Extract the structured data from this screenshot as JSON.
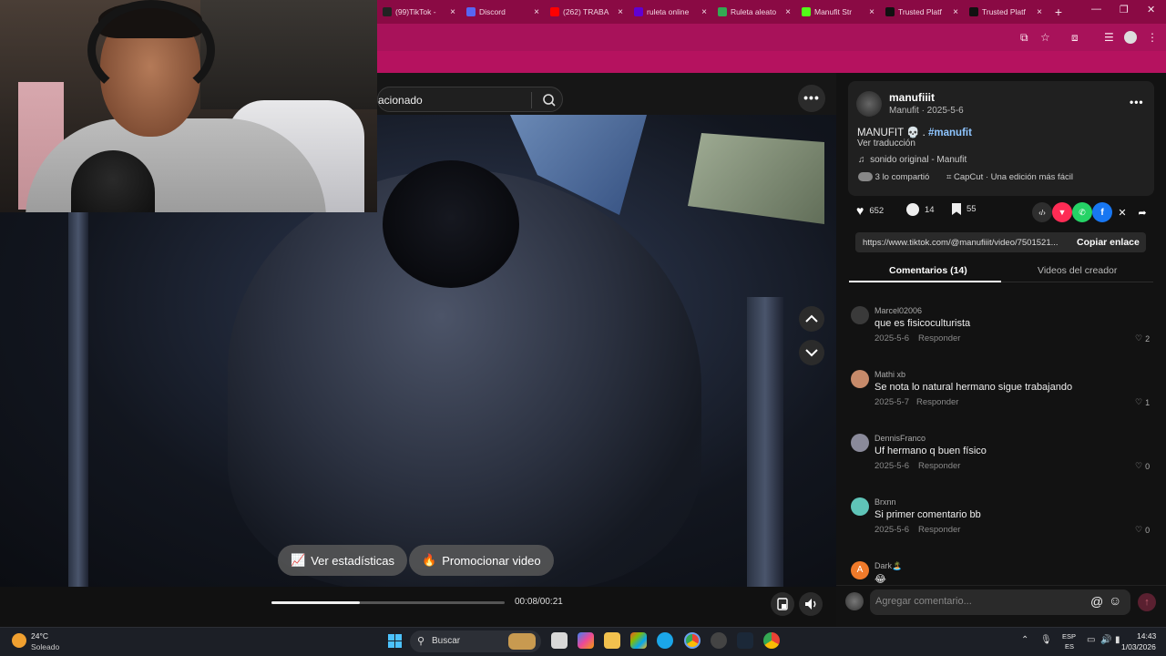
{
  "browser": {
    "tabs": [
      {
        "label": "(99)TikTok -",
        "color": "#222222"
      },
      {
        "label": "Discord",
        "color": "#5865f2"
      },
      {
        "label": "(262) TRABA",
        "color": "#ff0000"
      },
      {
        "label": "ruleta online",
        "color": "#6001d2"
      },
      {
        "label": "Ruleta aleato",
        "color": "#34a853"
      },
      {
        "label": "Manufit Str",
        "color": "#53fc18"
      },
      {
        "label": "Trusted Platf",
        "color": "#111111"
      },
      {
        "label": "Trusted Platf",
        "color": "#111111"
      }
    ],
    "close_glyph": "×",
    "new_tab_glyph": "+",
    "accent": "#8a0a44"
  },
  "search": {
    "value": "acionado"
  },
  "video": {
    "more_glyph": "•••",
    "stats_button": "Ver estadísticas",
    "promote_button": "Promocionar video",
    "time": "00:08/00:21",
    "progress": 0.38
  },
  "post": {
    "username": "manufiiit",
    "meta": "Manufit · 2025-5-6",
    "caption": "MANUFIT 💀 .",
    "hashtag": "#manufit",
    "translate": "Ver traducción",
    "sound": "sonido original - Manufit",
    "shared": "3 lo compartió",
    "capcut": "CapCut · Una edición más fácil",
    "likes": "652",
    "comments": "14",
    "saves": "55",
    "link": "https://www.tiktok.com/@manufiiit/video/7501521...",
    "copy_link": "Copiar enlace",
    "more_glyph": "•••"
  },
  "tabs": {
    "comments": "Comentarios (14)",
    "creator_videos": "Videos del creador"
  },
  "comments": [
    {
      "name": "Marcel02006",
      "text": "que es fisicoculturista",
      "date": "2025-5-6",
      "reply": "Responder",
      "likes": "2",
      "avatar_color": "#3a3a3a"
    },
    {
      "name": "Mathi xb",
      "text": "Se nota lo natural hermano sigue trabajando",
      "date": "2025-5-7",
      "reply": "Responder",
      "likes": "1",
      "avatar_color": "#c68a6a"
    },
    {
      "name": "DennisFranco",
      "text": "Uf hermano q buen físico",
      "date": "2025-5-6",
      "reply": "Responder",
      "likes": "0",
      "avatar_color": "#8a8a9a"
    },
    {
      "name": "Brxnn",
      "text": "Si primer comentario bb",
      "date": "2025-5-6",
      "reply": "Responder",
      "likes": "0",
      "avatar_color": "#5fc4b8"
    },
    {
      "name": "Dark🏝️",
      "text": "😂",
      "date": "",
      "reply": "",
      "likes": "",
      "avatar_color": "#f07a2a",
      "avatar_letter": "A"
    }
  ],
  "comment_input": {
    "placeholder": "Agregar comentario..."
  },
  "taskbar": {
    "temp": "24°C",
    "weather": "Soleado",
    "search": "Buscar",
    "lang1": "ESP",
    "lang2": "ES",
    "time": "14:43",
    "date": "1/03/2026"
  }
}
